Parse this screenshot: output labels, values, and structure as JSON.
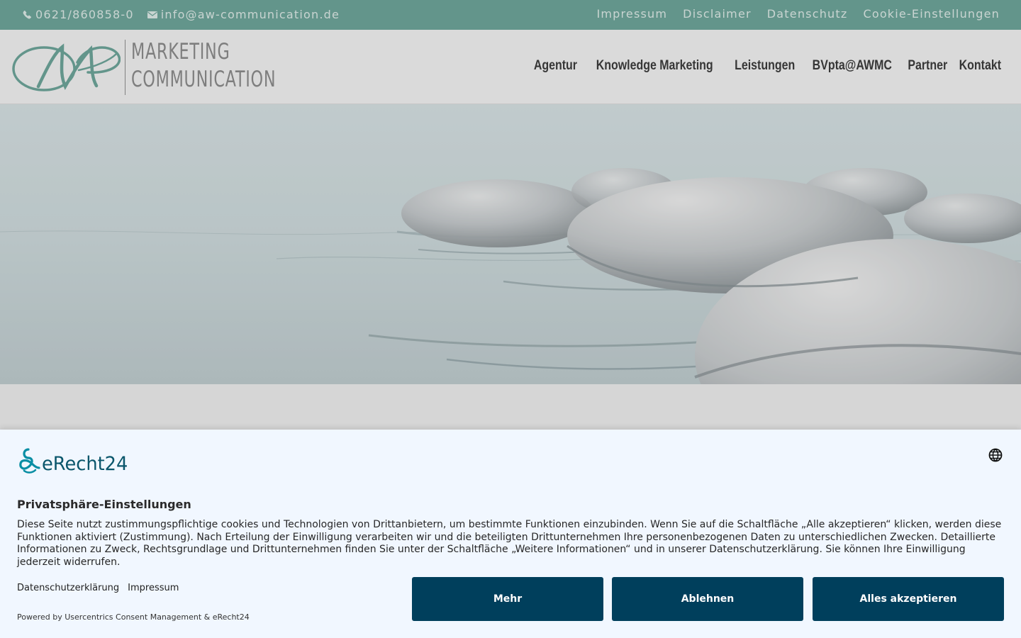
{
  "top_bar": {
    "phone": "0621/860858-0",
    "email": "info@aw-communication.de",
    "links": [
      "Impressum",
      "Disclaimer",
      "Datenschutz",
      "Cookie-Einstellungen"
    ]
  },
  "brand": {
    "logo_icon": "aw-monogram-logo",
    "line1": "MARKETING",
    "line2": "COMMUNICATION"
  },
  "nav": {
    "items": [
      "Agentur",
      "Knowledge Marketing",
      "Leistungen",
      "BVpta@AWMC",
      "Partner",
      "Kontakt"
    ]
  },
  "hero": {
    "image_icon": "zen-stones-in-water-image"
  },
  "consent": {
    "logo_text": "eRecht24",
    "language_icon": "globe-icon",
    "title": "Privatsphäre-Einstellungen",
    "text": "Diese Seite nutzt zustimmungspflichtige cookies und Technologien von Drittanbietern, um bestimmte Funktionen einzubinden. Wenn Sie auf die Schaltfläche „Alle akzeptieren“ klicken, werden diese Funktionen aktiviert (Zustimmung). Nach Erteilung der Einwilligung verarbeiten wir und die beteiligten Drittunternehmen Ihre personenbezogenen Daten zu unterschiedlichen Zwecken. Detaillierte Informationen zu Zweck, Rechtsgrundlage und Drittunternehmen finden Sie unter der Schaltfläche „Weitere Informationen“ und in unserer Datenschutzerklärung. Sie können Ihre Einwilligung jederzeit widerrufen.",
    "links": [
      "Datenschutzerklärung",
      "Impressum"
    ],
    "powered_by": "Powered by Usercentrics Consent Management & eRecht24",
    "buttons": {
      "more": "Mehr",
      "decline": "Ablehnen",
      "accept_all": "Alles akzeptieren"
    }
  },
  "colors": {
    "top_bar": "#6aa69a",
    "brand_teal": "#6aa69a",
    "consent_button": "#003f5c",
    "consent_background": "#f1f7ff"
  }
}
